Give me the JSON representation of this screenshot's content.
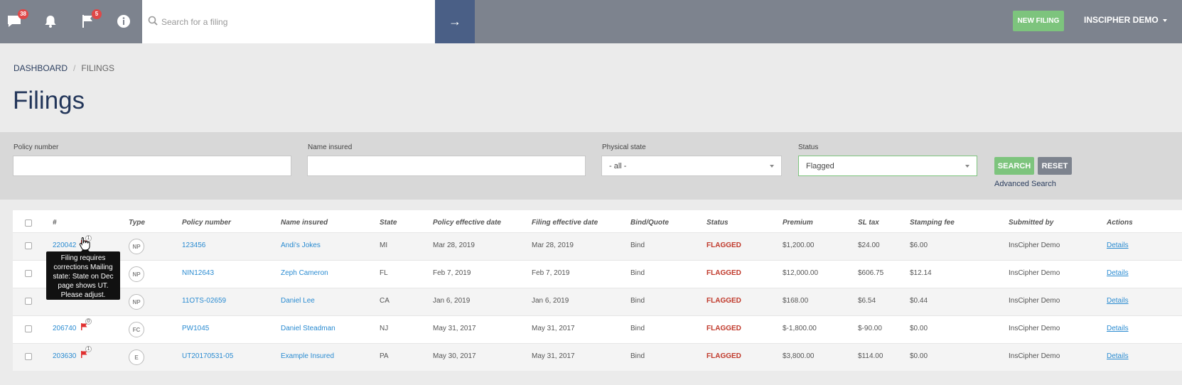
{
  "topbar": {
    "icons": [
      {
        "name": "chat-icon",
        "badge": "38"
      },
      {
        "name": "bell-icon",
        "badge": ""
      },
      {
        "name": "flag-icon",
        "badge": "5"
      },
      {
        "name": "info-icon",
        "badge": ""
      }
    ],
    "search_placeholder": "Search for a filing",
    "search_go_glyph": "→",
    "new_filing_label": "NEW FILING",
    "user_label": "INSCIPHER DEMO",
    "colors": {
      "bar": "#7d838e",
      "accent": "#7dc47d",
      "go": "#4a5f86",
      "badge": "#e04848"
    }
  },
  "breadcrumb": {
    "home": "DASHBOARD",
    "separator": "/",
    "current": "FILINGS"
  },
  "page_title": "Filings",
  "filters": {
    "policy_number": {
      "label": "Policy number",
      "value": ""
    },
    "name_insured": {
      "label": "Name insured",
      "value": ""
    },
    "physical_state": {
      "label": "Physical state",
      "value": "- all -"
    },
    "status": {
      "label": "Status",
      "value": "Flagged"
    },
    "search_label": "SEARCH",
    "reset_label": "RESET",
    "advanced_label": "Advanced Search"
  },
  "table": {
    "headers": [
      "#",
      "Type",
      "Policy number",
      "Name insured",
      "State",
      "Policy effective date",
      "Filing effective date",
      "Bind/Quote",
      "Status",
      "Premium",
      "SL tax",
      "Stamping fee",
      "Submitted by",
      "Actions"
    ],
    "rows": [
      {
        "id": "220042",
        "flag_count": "1",
        "type": "NP",
        "policy": "123456",
        "insured": "Andi's Jokes",
        "state": "MI",
        "policy_date": "Mar 28, 2019",
        "filing_date": "Mar 28, 2019",
        "bind": "Bind",
        "status": "FLAGGED",
        "premium": "$1,200.00",
        "sl_tax": "$24.00",
        "stamping": "$6.00",
        "submitted": "InsCipher Demo",
        "action": "Details"
      },
      {
        "id": "",
        "flag_count": "",
        "type": "NP",
        "policy": "NIN12643",
        "insured": "Zeph Cameron",
        "state": "FL",
        "policy_date": "Feb 7, 2019",
        "filing_date": "Feb 7, 2019",
        "bind": "Bind",
        "status": "FLAGGED",
        "premium": "$12,000.00",
        "sl_tax": "$606.75",
        "stamping": "$12.14",
        "submitted": "InsCipher Demo",
        "action": "Details"
      },
      {
        "id": "",
        "flag_count": "",
        "type": "NP",
        "policy": "11OTS-02659",
        "insured": "Daniel Lee",
        "state": "CA",
        "policy_date": "Jan 6, 2019",
        "filing_date": "Jan 6, 2019",
        "bind": "Bind",
        "status": "FLAGGED",
        "premium": "$168.00",
        "sl_tax": "$6.54",
        "stamping": "$0.44",
        "submitted": "InsCipher Demo",
        "action": "Details"
      },
      {
        "id": "206740",
        "flag_count": "0",
        "type": "FC",
        "policy": "PW1045",
        "insured": "Daniel Steadman",
        "state": "NJ",
        "policy_date": "May 31, 2017",
        "filing_date": "May 31, 2017",
        "bind": "Bind",
        "status": "FLAGGED",
        "premium": "$-1,800.00",
        "sl_tax": "$-90.00",
        "stamping": "$0.00",
        "submitted": "InsCipher Demo",
        "action": "Details"
      },
      {
        "id": "203630",
        "flag_count": "1",
        "type": "E",
        "policy": "UT20170531-05",
        "insured": "Example Insured",
        "state": "PA",
        "policy_date": "May 30, 2017",
        "filing_date": "May 31, 2017",
        "bind": "Bind",
        "status": "FLAGGED",
        "premium": "$3,800.00",
        "sl_tax": "$114.00",
        "stamping": "$0.00",
        "submitted": "InsCipher Demo",
        "action": "Details"
      }
    ]
  },
  "tooltip": {
    "text": "Filing requires corrections Mailing state: State on Dec page shows UT. Please adjust."
  }
}
